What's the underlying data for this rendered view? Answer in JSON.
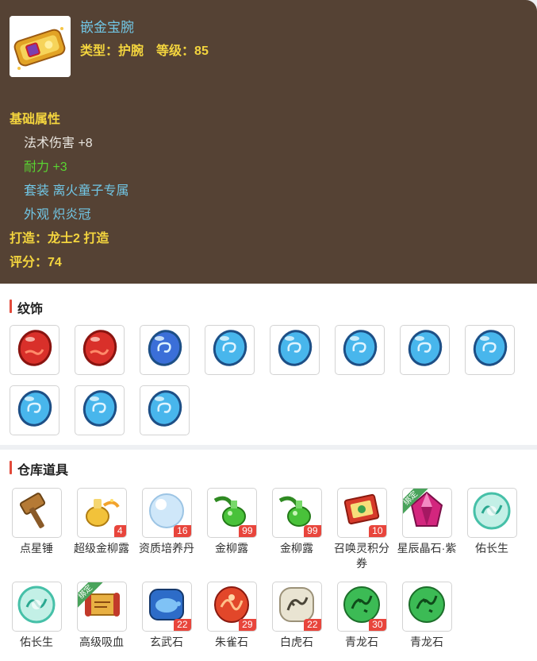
{
  "item": {
    "name": "嵌金宝腕",
    "type_label": "类型：",
    "type_value": "护腕",
    "level_label": "等级：",
    "level_value": "85",
    "section_base": "基础属性",
    "attr_magic": "法术伤害 +8",
    "attr_endurance": "耐力 +3",
    "attr_set": "套装 离火童子专属",
    "attr_appearance": "外观 炽炎冠",
    "forged_label": "打造：",
    "forged_value": "龙士2 打造",
    "score_label": "评分：",
    "score_value": "74"
  },
  "wenshi": {
    "title": "纹饰",
    "gems": [
      {
        "icon": "red-gem-icon",
        "color": "#d9302a"
      },
      {
        "icon": "red-gem-icon",
        "color": "#d9302a"
      },
      {
        "icon": "blue-swirl-gem-icon",
        "color": "#2f8fdc"
      },
      {
        "icon": "blue-gem-icon",
        "color": "#48b6ec"
      },
      {
        "icon": "blue-gem-icon",
        "color": "#48b6ec"
      },
      {
        "icon": "blue-gem-icon",
        "color": "#48b6ec"
      },
      {
        "icon": "blue-gem-icon",
        "color": "#48b6ec"
      },
      {
        "icon": "blue-gem-icon",
        "color": "#48b6ec"
      },
      {
        "icon": "blue-gem-icon",
        "color": "#48b6ec"
      },
      {
        "icon": "blue-gem-icon",
        "color": "#48b6ec"
      },
      {
        "icon": "blue-gem-icon",
        "color": "#48b6ec"
      }
    ]
  },
  "cangku": {
    "title": "仓库道具",
    "bind_text": "绑定",
    "items": [
      {
        "label": "点星锤",
        "count": "",
        "bound": false,
        "icon": "hammer-icon"
      },
      {
        "label": "超级金柳露",
        "count": "4",
        "bound": false,
        "icon": "gold-bottle-icon"
      },
      {
        "label": "资质培养丹",
        "count": "16",
        "bound": false,
        "icon": "pearl-icon"
      },
      {
        "label": "金柳露",
        "count": "99",
        "bound": false,
        "icon": "green-bottle-icon"
      },
      {
        "label": "金柳露",
        "count": "99",
        "bound": false,
        "icon": "green-bottle-icon"
      },
      {
        "label": "召唤灵积分券",
        "count": "10",
        "bound": false,
        "icon": "coupon-icon"
      },
      {
        "label": "星辰晶石·紫",
        "count": "",
        "bound": true,
        "icon": "purple-crystal-icon"
      },
      {
        "label": "佑长生",
        "count": "",
        "bound": false,
        "icon": "cyan-orb-icon"
      },
      {
        "label": "佑长生",
        "count": "",
        "bound": false,
        "icon": "cyan-orb-icon"
      },
      {
        "label": "高级吸血",
        "count": "",
        "bound": true,
        "icon": "scroll-icon"
      },
      {
        "label": "玄武石",
        "count": "22",
        "bound": false,
        "icon": "blue-turtle-stone-icon"
      },
      {
        "label": "朱雀石",
        "count": "29",
        "bound": false,
        "icon": "red-bird-stone-icon"
      },
      {
        "label": "白虎石",
        "count": "22",
        "bound": false,
        "icon": "white-tiger-stone-icon"
      },
      {
        "label": "青龙石",
        "count": "30",
        "bound": false,
        "icon": "green-dragon-stone-icon"
      },
      {
        "label": "青龙石",
        "count": "",
        "bound": false,
        "icon": "green-dragon-stone-icon"
      }
    ]
  }
}
